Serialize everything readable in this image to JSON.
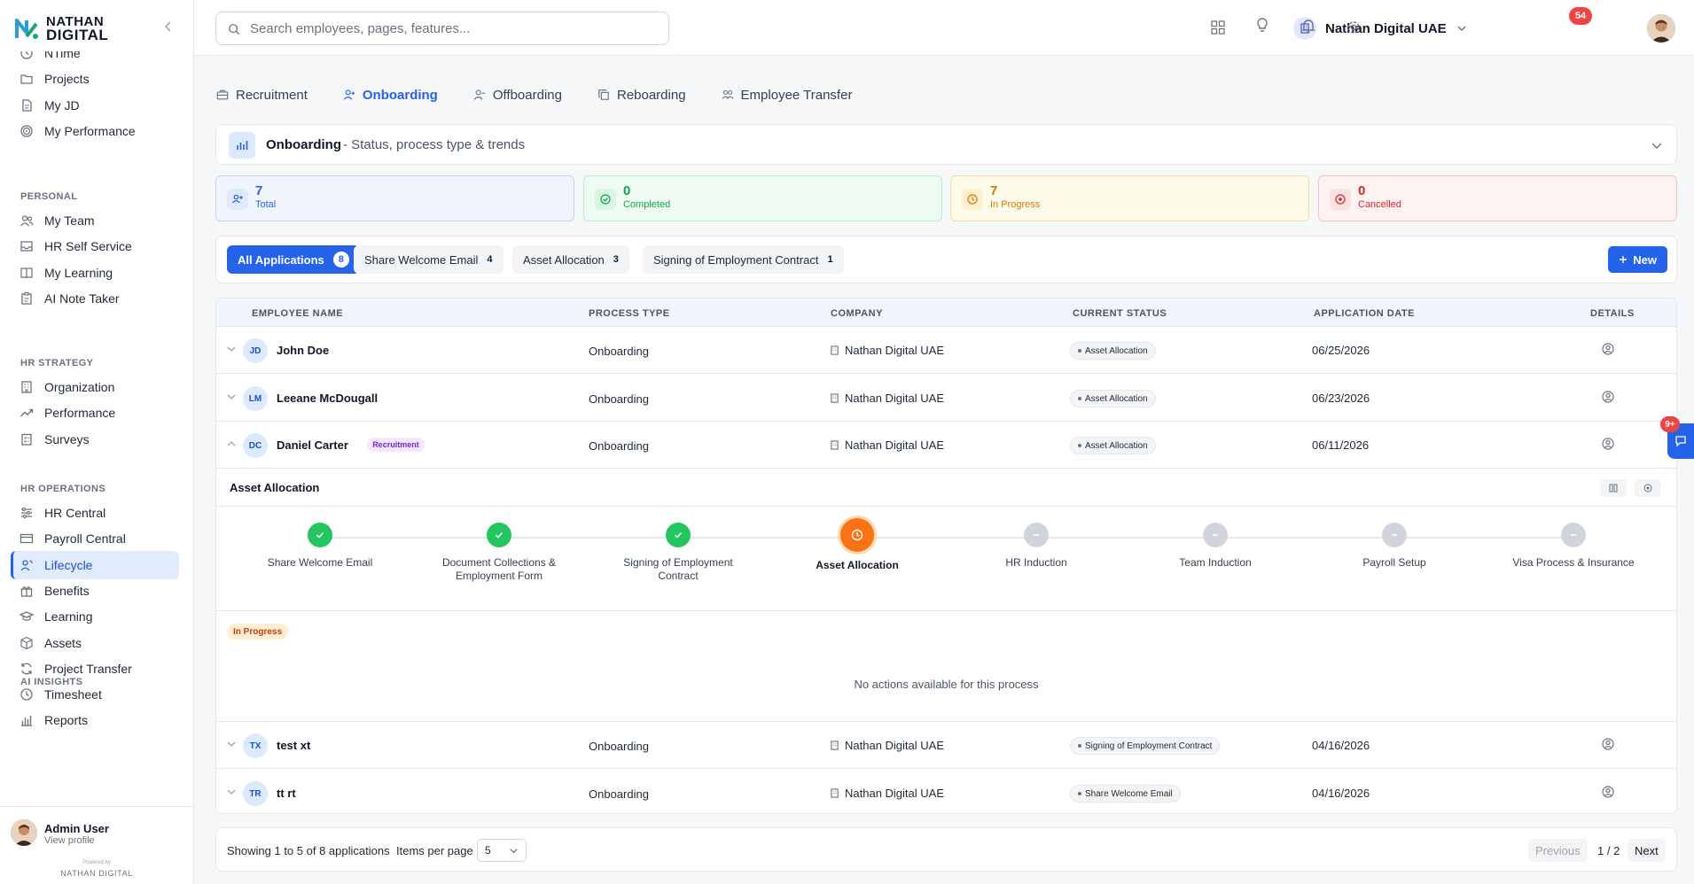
{
  "brand": {
    "line1": "NATHAN",
    "line2": "DIGITAL",
    "powered_by": "Powered by",
    "powered_brand": "NATHAN DIGITAL"
  },
  "sidebar": {
    "items_top": [
      {
        "label": "NTime",
        "icon": "clock-icon"
      },
      {
        "label": "Projects",
        "icon": "folder-icon"
      },
      {
        "label": "My JD",
        "icon": "document-icon"
      },
      {
        "label": "My Performance",
        "icon": "target-icon"
      }
    ],
    "sections": [
      {
        "title": "PERSONAL",
        "items": [
          {
            "label": "My Team",
            "icon": "users-icon"
          },
          {
            "label": "HR Self Service",
            "icon": "inbox-icon"
          },
          {
            "label": "My Learning",
            "icon": "book-icon"
          },
          {
            "label": "AI Note Taker",
            "icon": "clipboard-icon"
          }
        ]
      },
      {
        "title": "HR STRATEGY",
        "items": [
          {
            "label": "Organization",
            "icon": "building-icon"
          },
          {
            "label": "Performance",
            "icon": "trend-icon"
          },
          {
            "label": "Surveys",
            "icon": "survey-icon"
          }
        ]
      },
      {
        "title": "HR OPERATIONS",
        "items": [
          {
            "label": "HR Central",
            "icon": "sliders-icon"
          },
          {
            "label": "Payroll Central",
            "icon": "card-icon"
          },
          {
            "label": "Lifecycle",
            "icon": "user-cycle-icon",
            "active": true
          },
          {
            "label": "Benefits",
            "icon": "gift-icon"
          },
          {
            "label": "Learning",
            "icon": "graduation-icon"
          },
          {
            "label": "Assets",
            "icon": "box-icon"
          },
          {
            "label": "Project Transfer",
            "icon": "refresh-icon"
          },
          {
            "label": "Timesheet",
            "icon": "clock-icon"
          },
          {
            "label": "Reports",
            "icon": "bar-chart-icon"
          }
        ]
      },
      {
        "title": "AI INSIGHTS",
        "items": []
      }
    ],
    "user": {
      "name": "Admin User",
      "link": "View profile"
    }
  },
  "topbar": {
    "search_placeholder": "Search employees, pages, features...",
    "company": "Nathan Digital UAE",
    "notifications": "54",
    "icons": [
      "grid-icon",
      "bulb-icon",
      "bell-icon",
      "gear-icon"
    ]
  },
  "tabs": [
    {
      "label": "Recruitment",
      "icon": "briefcase-icon"
    },
    {
      "label": "Onboarding",
      "icon": "user-plus-icon",
      "active": true
    },
    {
      "label": "Offboarding",
      "icon": "user-minus-icon"
    },
    {
      "label": "Reboarding",
      "icon": "copy-icon"
    },
    {
      "label": "Employee Transfer",
      "icon": "transfer-icon"
    }
  ],
  "summary": {
    "title": "Onboarding",
    "subtitle": "- Status, process type & trends",
    "stats": [
      {
        "value": "7",
        "label": "Total",
        "color": "#2563eb",
        "bg": "#f1f6fe",
        "border": "#bfd3f5"
      },
      {
        "value": "0",
        "label": "Completed",
        "color": "#16a34a",
        "bg": "#eefbf3",
        "border": "#b7ebc9"
      },
      {
        "value": "7",
        "label": "In Progress",
        "color": "#d97706",
        "bg": "#fffbeb",
        "border": "#f7dc9c"
      },
      {
        "value": "0",
        "label": "Cancelled",
        "color": "#dc2626",
        "bg": "#fef2f2",
        "border": "#f6c4c4"
      }
    ]
  },
  "filters": {
    "chips": [
      {
        "label": "All Applications",
        "count": "8",
        "active": true
      },
      {
        "label": "Share Welcome Email",
        "count": "4"
      },
      {
        "label": "Asset Allocation",
        "count": "3"
      },
      {
        "label": "Signing of Employment Contract",
        "count": "1"
      }
    ],
    "new_label": "New"
  },
  "table": {
    "headers": [
      "EMPLOYEE NAME",
      "PROCESS TYPE",
      "COMPANY",
      "CURRENT STATUS",
      "APPLICATION DATE",
      "DETAILS"
    ],
    "rows": [
      {
        "initials": "JD",
        "name": "John Doe",
        "tag": "",
        "process": "Onboarding",
        "company": "Nathan Digital UAE",
        "status": "Asset Allocation",
        "date": "06/25/2026"
      },
      {
        "initials": "LM",
        "name": "Leeane McDougall",
        "tag": "",
        "process": "Onboarding",
        "company": "Nathan Digital UAE",
        "status": "Asset Allocation",
        "date": "06/23/2026"
      },
      {
        "initials": "DC",
        "name": "Daniel Carter",
        "tag": "Recruitment",
        "process": "Onboarding",
        "company": "Nathan Digital UAE",
        "status": "Asset Allocation",
        "date": "06/11/2026",
        "expanded": true
      },
      {
        "initials": "TX",
        "name": "test xt",
        "tag": "",
        "process": "Onboarding",
        "company": "Nathan Digital UAE",
        "status": "Signing of Employment Contract",
        "date": "04/16/2026"
      },
      {
        "initials": "TR",
        "name": "tt rt",
        "tag": "",
        "process": "Onboarding",
        "company": "Nathan Digital UAE",
        "status": "Share Welcome Email",
        "date": "04/16/2026"
      }
    ],
    "expanded": {
      "title": "Asset Allocation",
      "steps": [
        {
          "label": "Share Welcome Email",
          "state": "done"
        },
        {
          "label": "Document Collections & Employment Form",
          "state": "done"
        },
        {
          "label": "Signing of Employment Contract",
          "state": "done"
        },
        {
          "label": "Asset Allocation",
          "state": "current"
        },
        {
          "label": "HR Induction",
          "state": "pending"
        },
        {
          "label": "Team Induction",
          "state": "pending"
        },
        {
          "label": "Payroll Setup",
          "state": "pending"
        },
        {
          "label": "Visa Process & Insurance",
          "state": "pending"
        }
      ],
      "status_badge": "In Progress",
      "empty_message": "No actions available for this process"
    }
  },
  "pagination": {
    "info": "Showing 1 to 5 of 8 applications",
    "items_per_page_label": "Items per page",
    "items_per_page": "5",
    "prev": "Previous",
    "page": "1 / 2",
    "next": "Next"
  },
  "chat": {
    "badge": "9+"
  }
}
